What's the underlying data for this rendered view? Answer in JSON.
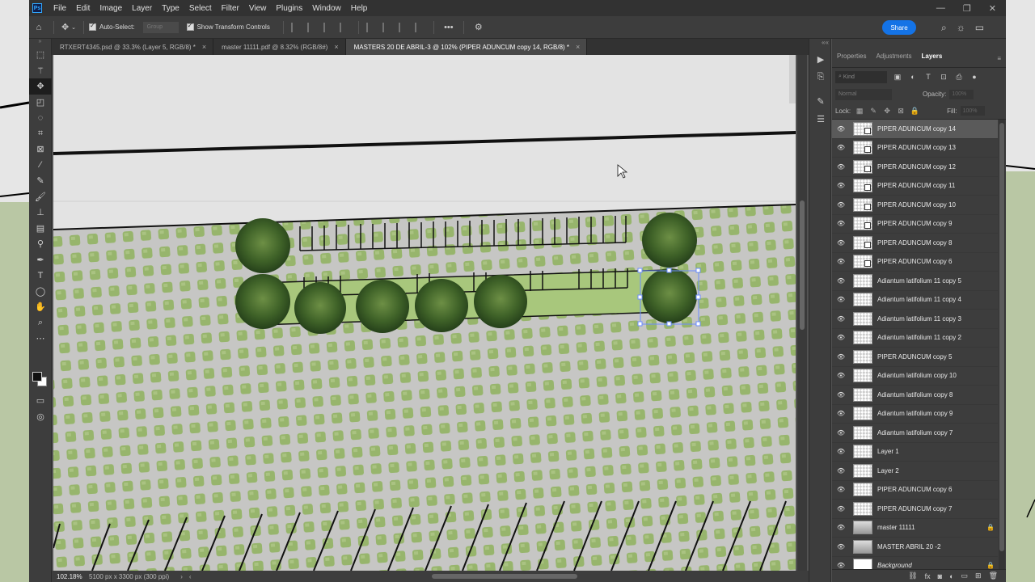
{
  "app": {
    "logo": "Ps",
    "menu": [
      "File",
      "Edit",
      "Image",
      "Layer",
      "Type",
      "Select",
      "Filter",
      "View",
      "Plugins",
      "Window",
      "Help"
    ],
    "window_controls": [
      "—",
      "❐",
      "✕"
    ]
  },
  "options": {
    "auto_select_label": "Auto-Select:",
    "auto_select_target": "Group",
    "transform_controls_label": "Show Transform Controls",
    "more_label": "•••",
    "share_label": "Share"
  },
  "tabs": [
    {
      "label": "RTXERT4345.psd @ 33.3% (Layer 5, RGB/8) *",
      "active": false
    },
    {
      "label": "master 11111.pdf @ 8.32% (RGB/8#)",
      "active": false
    },
    {
      "label": "MASTERS 20 DE ABRIL-3 @ 102% (PIPER ADUNCUM copy 14, RGB/8) *",
      "active": true
    }
  ],
  "status": {
    "zoom": "102.18%",
    "doc_info": "5100 px x 3300 px (300 ppi)"
  },
  "panel": {
    "tabs": [
      "Properties",
      "Adjustments",
      "Layers"
    ],
    "active_tab": "Layers",
    "kind_placeholder": "Kind",
    "blend_mode": "Normal",
    "opacity_label": "Opacity:",
    "opacity_value": "100%",
    "lock_label": "Lock:",
    "fill_label": "Fill:",
    "fill_value": "100%"
  },
  "layers": [
    {
      "name": "PIPER ADUNCUM copy 14",
      "thumb": "smart",
      "selected": true
    },
    {
      "name": "PIPER ADUNCUM copy 13",
      "thumb": "smart"
    },
    {
      "name": "PIPER ADUNCUM copy 12",
      "thumb": "smart"
    },
    {
      "name": "PIPER ADUNCUM copy 11",
      "thumb": "smart"
    },
    {
      "name": "PIPER ADUNCUM copy 10",
      "thumb": "smart"
    },
    {
      "name": "PIPER ADUNCUM copy 9",
      "thumb": "smart"
    },
    {
      "name": "PIPER ADUNCUM copy 8",
      "thumb": "smart"
    },
    {
      "name": "PIPER ADUNCUM copy 6",
      "thumb": "smart"
    },
    {
      "name": "Adiantum latifolium 11 copy 5",
      "thumb": "checker"
    },
    {
      "name": "Adiantum latifolium 11 copy 4",
      "thumb": "checker"
    },
    {
      "name": "Adiantum latifolium 11 copy 3",
      "thumb": "checker"
    },
    {
      "name": "Adiantum latifolium 11 copy 2",
      "thumb": "checker"
    },
    {
      "name": "PIPER ADUNCUM copy 5",
      "thumb": "checker"
    },
    {
      "name": "Adiantum latifolium copy 10",
      "thumb": "checker"
    },
    {
      "name": "Adiantum latifolium copy 8",
      "thumb": "checker"
    },
    {
      "name": "Adiantum latifolium copy 9",
      "thumb": "checker"
    },
    {
      "name": "Adiantum latifolium copy 7",
      "thumb": "checker"
    },
    {
      "name": "Layer 1",
      "thumb": "checker"
    },
    {
      "name": "Layer 2",
      "thumb": "checker"
    },
    {
      "name": "PIPER ADUNCUM copy 6",
      "thumb": "checker"
    },
    {
      "name": "PIPER ADUNCUM copy 7",
      "thumb": "checker"
    },
    {
      "name": "master 11111",
      "thumb": "master",
      "locked": true
    },
    {
      "name": "MASTER ABRIL 20 -2",
      "thumb": "master"
    },
    {
      "name": "Background",
      "thumb": "plain",
      "locked": true,
      "italic": true
    }
  ],
  "colors": {
    "accent": "#1473e6",
    "panel_bg": "#3d3d3d",
    "grass": "#9cc06a",
    "paver": "#c9c9c9"
  }
}
